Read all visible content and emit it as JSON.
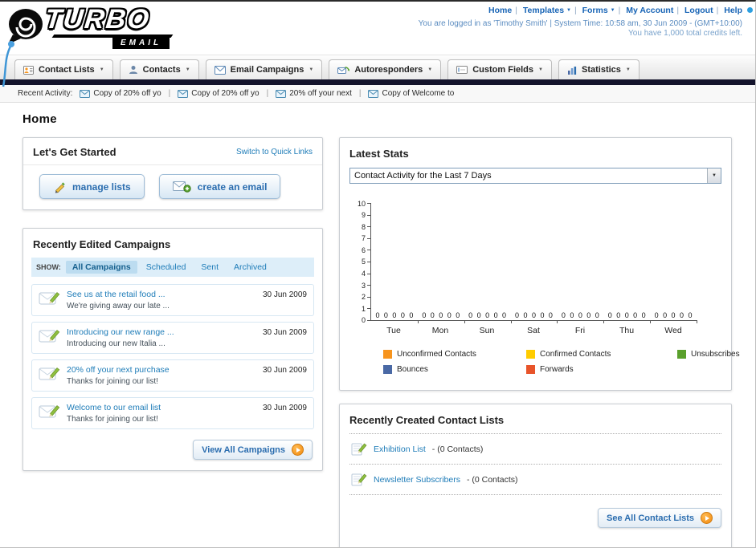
{
  "header": {
    "logo_title": "TURBO",
    "logo_subtitle": "EMAIL",
    "links": [
      {
        "label": "Home"
      },
      {
        "label": "Templates"
      },
      {
        "label": "Forms"
      },
      {
        "label": "My Account"
      },
      {
        "label": "Logout"
      },
      {
        "label": "Help"
      }
    ],
    "login_info": "You are logged in as 'Timothy Smith' | System Time: 10:58 am, 30 Jun 2009 - (GMT+10:00)",
    "credits_info": "You have 1,000 total credits left."
  },
  "nav": {
    "tabs": [
      {
        "label": "Contact Lists"
      },
      {
        "label": "Contacts"
      },
      {
        "label": "Email Campaigns"
      },
      {
        "label": "Autoresponders"
      },
      {
        "label": "Custom Fields"
      },
      {
        "label": "Statistics"
      }
    ]
  },
  "recent_activity": {
    "label": "Recent Activity:",
    "items": [
      "Copy of 20% off yo",
      "Copy of 20% off yo",
      "20% off your next",
      "Copy of Welcome to"
    ]
  },
  "page_title": "Home",
  "get_started": {
    "title": "Let's Get Started",
    "switch_link": "Switch to Quick Links",
    "manage_lists_label": "manage lists",
    "create_email_label": "create an email"
  },
  "campaigns": {
    "title": "Recently Edited Campaigns",
    "show_label": "SHOW:",
    "filters": [
      "All Campaigns",
      "Scheduled",
      "Sent",
      "Archived"
    ],
    "active_filter": "All Campaigns",
    "items": [
      {
        "title": "See us at the retail food ...",
        "subtitle": "We're giving away our late ...",
        "date": "30 Jun 2009"
      },
      {
        "title": "Introducing our new range ...",
        "subtitle": "Introducing our new Italia ...",
        "date": "30 Jun 2009"
      },
      {
        "title": "20% off your next purchase",
        "subtitle": "Thanks for joining our list!",
        "date": "30 Jun 2009"
      },
      {
        "title": "Welcome to our email list",
        "subtitle": "Thanks for joining our list!",
        "date": "30 Jun 2009"
      }
    ],
    "view_all_label": "View All Campaigns"
  },
  "stats": {
    "title": "Latest Stats",
    "dropdown_value": "Contact Activity for the Last 7 Days",
    "chart_data": {
      "type": "bar",
      "categories": [
        "Tue",
        "Mon",
        "Sun",
        "Sat",
        "Fri",
        "Thu",
        "Wed"
      ],
      "series": [
        {
          "name": "Unconfirmed Contacts",
          "color": "#f7941d",
          "values": [
            0,
            0,
            0,
            0,
            0,
            0,
            0
          ]
        },
        {
          "name": "Confirmed Contacts",
          "color": "#ffcc00",
          "values": [
            0,
            0,
            0,
            0,
            0,
            0,
            0
          ]
        },
        {
          "name": "Unsubscribes",
          "color": "#5aa02c",
          "values": [
            0,
            0,
            0,
            0,
            0,
            0,
            0
          ]
        },
        {
          "name": "Bounces",
          "color": "#4a69a5",
          "values": [
            0,
            0,
            0,
            0,
            0,
            0,
            0
          ]
        },
        {
          "name": "Forwards",
          "color": "#e8542a",
          "values": [
            0,
            0,
            0,
            0,
            0,
            0,
            0
          ]
        }
      ],
      "ylim": [
        0,
        10
      ],
      "yticks": [
        0,
        1,
        2,
        3,
        4,
        5,
        6,
        7,
        8,
        9,
        10
      ],
      "grid": false,
      "legend_position": "bottom"
    }
  },
  "contact_lists": {
    "title": "Recently Created Contact Lists",
    "items": [
      {
        "name": "Exhibition List",
        "suffix": "- (0 Contacts)"
      },
      {
        "name": "Newsletter Subscribers",
        "suffix": "- (0 Contacts)"
      }
    ],
    "see_all_label": "See All Contact Lists"
  }
}
